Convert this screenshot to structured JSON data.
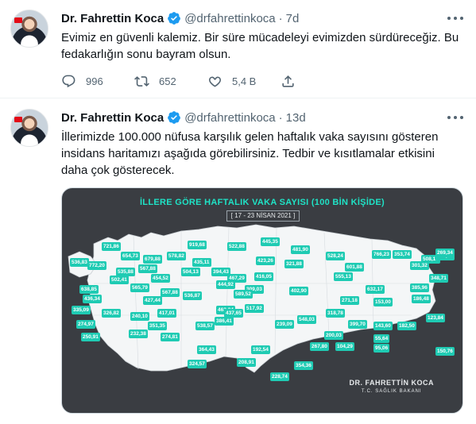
{
  "tweets": [
    {
      "author_name": "Dr. Fahrettin Koca",
      "handle": "@drfahrettinkoca",
      "separator": "·",
      "time": "7d",
      "text": "Evimiz en güvenli kalemiz. Bir süre mücadeleyi evimizden sürdüreceğiz. Bu fedakarlığın sonu bayram olsun.",
      "replies": "996",
      "retweets": "652",
      "likes": "5,4 B"
    },
    {
      "author_name": "Dr. Fahrettin Koca",
      "handle": "@drfahrettinkoca",
      "separator": "·",
      "time": "13d",
      "text": "İllerimizde 100.000 nüfusa karşılık gelen haftalık vaka sayısını gösteren insidans haritamızı aşağıda görebilirsiniz. Tedbir ve kısıtlamalar etkisini daha çok gösterecek."
    }
  ],
  "map": {
    "title": "İLLERE GÖRE HAFTALIK VAKA SAYISI (100 BİN KİŞİDE)",
    "date_range": "[ 17 - 23 NİSAN 2021 ]",
    "signature_name": "DR. FAHRETTİN KOCA",
    "signature_role": "T.C. SAĞLIK BAKANI",
    "labels": [
      "721,86",
      "654,73",
      "919,68",
      "522,88",
      "445,35",
      "481,90",
      "528,24",
      "766,23",
      "353,74",
      "508,19",
      "259,15",
      "269,34",
      "536,83",
      "772,20",
      "679,88",
      "578,82",
      "435,11",
      "423,26",
      "321,88",
      "601,88",
      "301,32",
      "348,71",
      "535,88",
      "567,88",
      "454,52",
      "504,13",
      "394,43",
      "467,29",
      "416,05",
      "555,13",
      "502,41",
      "565,79",
      "567,88",
      "444,92",
      "309,03",
      "402,90",
      "632,17",
      "385,96",
      "638,85",
      "436,34",
      "427,44",
      "536,87",
      "589,52",
      "271,18",
      "153,00",
      "186,48",
      "335,09",
      "326,82",
      "240,10",
      "417,01",
      "463,34",
      "517,92",
      "318,78",
      "548,03",
      "399,70",
      "143,60",
      "182,50",
      "123,84",
      "274,97",
      "351,35",
      "386,41",
      "437,65",
      "239,09",
      "200,03",
      "104,29",
      "55,64",
      "150,76",
      "250,91",
      "232,38",
      "274,81",
      "538,57",
      "364,43",
      "192,54",
      "267,80",
      "95,06",
      "324,57",
      "208,91",
      "354,36",
      "228,74"
    ]
  },
  "colors": {
    "label_bg": "#1fcbb3",
    "map_land": "#f4f6f7",
    "map_bg": "#3a3d42",
    "verified": "#1d9bf0"
  }
}
